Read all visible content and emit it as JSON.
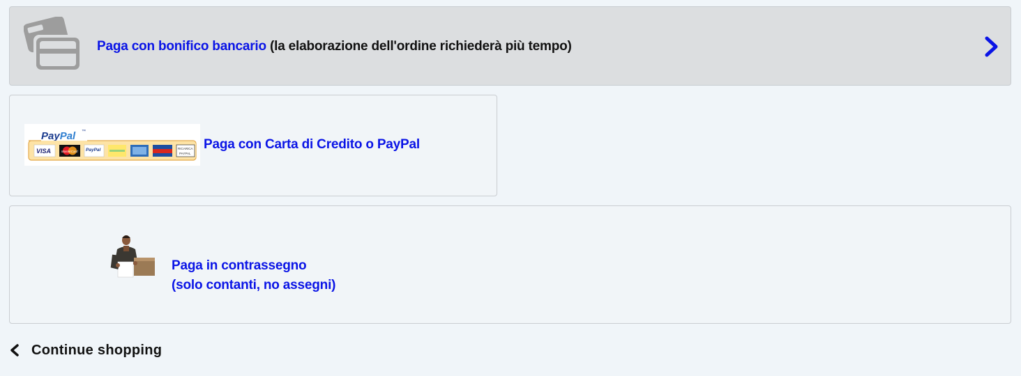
{
  "payments": {
    "bank": {
      "link_text": "Paga con bonifico bancario",
      "note": "(la elaborazione dell'ordine richiederà più tempo)",
      "icon": "credit-card-icon",
      "arrow_icon": "chevron-right-icon"
    },
    "paypal": {
      "label": "Paga con Carta di Credito o PayPal",
      "logo_text": "PayPal",
      "card_badges": [
        "VISA",
        "MasterCard",
        "PayPal",
        "",
        "",
        "",
        "RICARICA PAYPAL"
      ]
    },
    "cod": {
      "line1": "Paga in contrassegno",
      "line2": "(solo contanti, no assegni)"
    }
  },
  "footer": {
    "continue_label": "Continue shopping",
    "back_icon": "chevron-left-icon"
  },
  "colors": {
    "link_blue": "#0a14e6",
    "page_bg": "#f0f5f9",
    "selected_panel_bg": "#dcdee0",
    "icon_grey": "#9a9a9a"
  }
}
